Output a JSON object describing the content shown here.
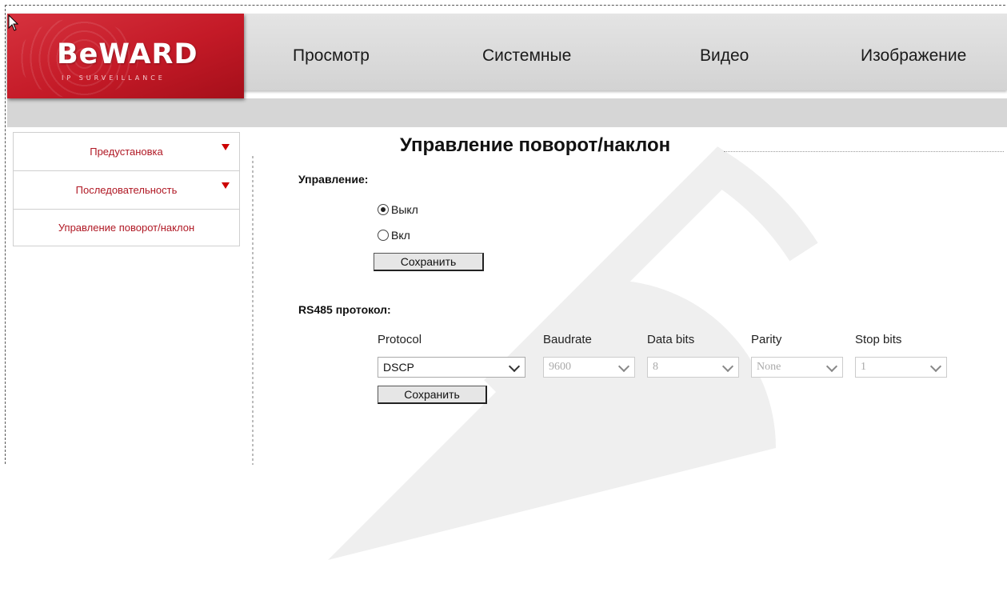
{
  "logo": {
    "brand": "BeWARD",
    "tagline": "IP SURVEILLANCE"
  },
  "nav": {
    "items": [
      "Просмотр",
      "Системные",
      "Видео",
      "Изображение"
    ]
  },
  "sidebar": {
    "items": [
      {
        "label": "Предустановка",
        "has_arrow": true
      },
      {
        "label": "Последовательность",
        "has_arrow": true
      },
      {
        "label": "Управление поворот/наклон",
        "has_arrow": false
      }
    ]
  },
  "page": {
    "title": "Управление поворот/наклон",
    "control": {
      "label": "Управление:",
      "options": [
        "Выкл",
        "Вкл"
      ],
      "selected": "Выкл",
      "save_label": "Сохранить"
    },
    "rs485": {
      "label": "RS485 протокол:",
      "columns": [
        "Protocol",
        "Baudrate",
        "Data bits",
        "Parity",
        "Stop bits"
      ],
      "values": [
        "DSCP",
        "9600",
        "8",
        "None",
        "1"
      ],
      "save_label": "Сохранить"
    }
  },
  "colors": {
    "brand_red": "#c41a27",
    "sidebar_text": "#b01824"
  }
}
